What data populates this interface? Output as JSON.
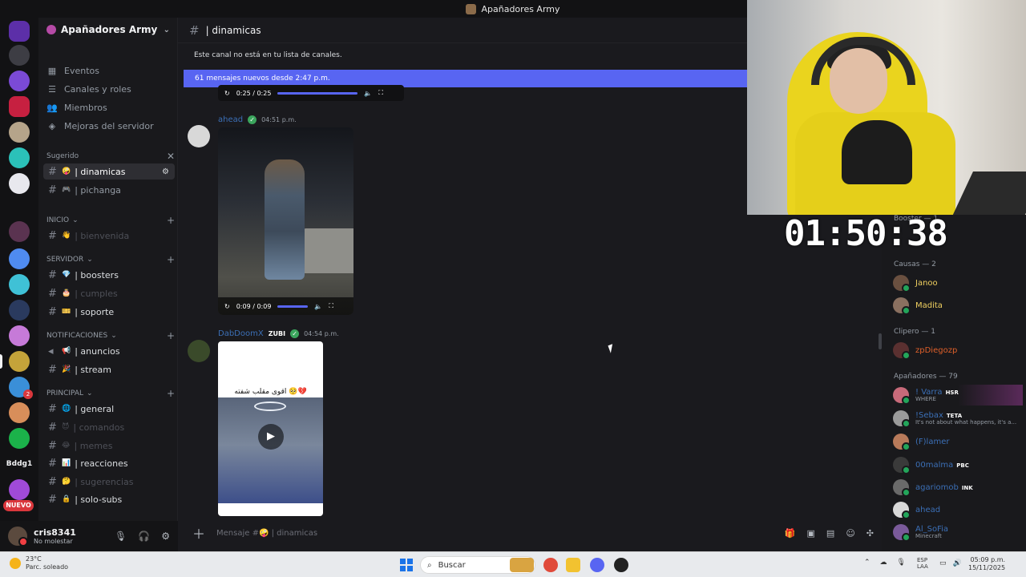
{
  "window": {
    "title": "Apañadores Army"
  },
  "server": {
    "name": "Apañadores Army",
    "nav": [
      {
        "icon": "calendar-icon",
        "label": "Eventos"
      },
      {
        "icon": "list-icon",
        "label": "Canales y roles"
      },
      {
        "icon": "members-icon",
        "label": "Miembros"
      },
      {
        "icon": "boost-icon",
        "label": "Mejoras del servidor"
      }
    ],
    "suggested_label": "Sugerido",
    "suggested_channels": [
      {
        "emoji": "🤪",
        "name": "| dinamicas",
        "active": true
      },
      {
        "emoji": "🎮",
        "name": "| pichanga"
      }
    ],
    "categories": [
      {
        "name": "INICIO",
        "channels": [
          {
            "emoji": "👋",
            "name": "| bienvenida"
          }
        ]
      },
      {
        "name": "SERVIDOR",
        "channels": [
          {
            "emoji": "💎",
            "name": "| boosters"
          },
          {
            "emoji": "🎂",
            "name": "| cumples"
          },
          {
            "emoji": "🎫",
            "name": "| soporte"
          }
        ]
      },
      {
        "name": "NOTIFICACIONES",
        "channels": [
          {
            "emoji": "📢",
            "name": "| anuncios"
          },
          {
            "emoji": "🎉",
            "name": "| stream"
          }
        ]
      },
      {
        "name": "PRINCIPAL",
        "channels": [
          {
            "emoji": "🌐",
            "name": "| general"
          },
          {
            "emoji": "😈",
            "name": "| comandos"
          },
          {
            "emoji": "😂",
            "name": "| memes"
          },
          {
            "emoji": "📊",
            "name": "| reacciones"
          },
          {
            "emoji": "🤔",
            "name": "| sugerencias"
          },
          {
            "emoji": "🔒",
            "name": "| solo-subs"
          }
        ]
      }
    ]
  },
  "rail": {
    "text_server": "Bddg1",
    "new_label": "NUEVO",
    "notif_count": "2"
  },
  "user": {
    "name": "cris8341",
    "status": "No molestar"
  },
  "channel": {
    "name": "| dinamicas",
    "notice": "Este canal no está en tu lista de canales.",
    "new_messages": "61 mensajes nuevos desde 2:47 p.m.",
    "top_audio_time": "0:25 / 0:25",
    "messages": [
      {
        "author": "ahead",
        "time": "04:51 p.m.",
        "video_time": "0:09 / 0:09",
        "author_color": "#3b6fb6"
      },
      {
        "author": "DabDoomX",
        "tag": "ZUBI",
        "time": "04:54 p.m.",
        "caption": "اقوى مقلب شفته 🥺💔",
        "author_color": "#3b6fb6"
      }
    ],
    "composer_placeholder": "Mensaje #🤪 | dinamicas"
  },
  "timer": "01:50:38",
  "members": {
    "partial_header": "Booster — 1",
    "groups": [
      {
        "name": "Causas — 2",
        "members": [
          {
            "name": "Janoo",
            "color": "#f0d060"
          },
          {
            "name": "Madita",
            "color": "#f0d060"
          }
        ]
      },
      {
        "name": "Clipero — 1",
        "members": [
          {
            "name": "zpDiegozp",
            "color": "#e0602a"
          }
        ]
      },
      {
        "name": "Apañadores — 79",
        "members": [
          {
            "name": "! Varra",
            "tag": "HSR",
            "status": "WHERE",
            "color": "#3b6fb6"
          },
          {
            "name": "!Sebax",
            "tag": "TETA",
            "status": "It's not about what happens, it's a...",
            "color": "#3b6fb6"
          },
          {
            "name": "(F)lamer",
            "color": "#3b6fb6"
          },
          {
            "name": "00malma",
            "tag": "PBC",
            "color": "#3b6fb6"
          },
          {
            "name": "agariomob",
            "tag": "INK",
            "color": "#3b6fb6"
          },
          {
            "name": "ahead",
            "color": "#3b6fb6"
          },
          {
            "name": "Al_SoFia",
            "status": "Minecraft",
            "color": "#3b6fb6"
          }
        ]
      }
    ]
  },
  "taskbar": {
    "temp": "23°C",
    "weather": "Parc. soleado",
    "search": "Buscar",
    "lang1": "ESP",
    "lang2": "LAA",
    "time": "05:09 p.m.",
    "date": "15/11/2025"
  }
}
